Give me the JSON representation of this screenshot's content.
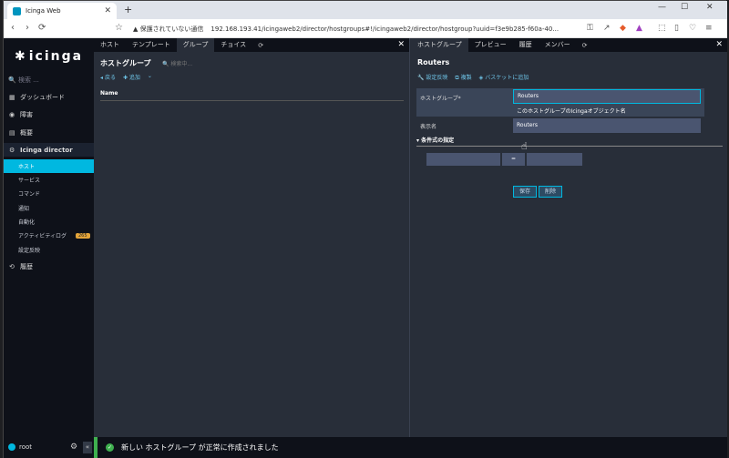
{
  "browser": {
    "tab_title": "Icinga Web",
    "new_tab": "+",
    "security_warning": "▲ 保護されていない通信",
    "url": "192.168.193.41/icingaweb2/director/hostgroups#!/icingaweb2/director/hostgroup?uuid=f3e9b285-f60a-40..."
  },
  "sidebar": {
    "logo": "icinga",
    "search": "検索 ...",
    "items": [
      {
        "label": "ダッシュボード",
        "icon": "dashboard-icon"
      },
      {
        "label": "障害",
        "icon": "problems-icon"
      },
      {
        "label": "概要",
        "icon": "overview-icon"
      },
      {
        "label": "Icinga director",
        "icon": "director-icon"
      },
      {
        "label": "ホスト"
      },
      {
        "label": "サービス"
      },
      {
        "label": "コマンド"
      },
      {
        "label": "通知"
      },
      {
        "label": "自動化"
      },
      {
        "label": "アクティビティログ",
        "badge": "265"
      },
      {
        "label": "設定反映"
      },
      {
        "label": "履歴",
        "icon": "history-icon"
      }
    ],
    "user": "root"
  },
  "left_panel": {
    "tabs": [
      "ホスト",
      "テンプレート",
      "グループ",
      "チョイス"
    ],
    "active_tab": "グループ",
    "title": "ホストグループ",
    "search_placeholder": "検索中...",
    "back": "戻る",
    "add": "追加",
    "column_name": "Name"
  },
  "right_panel": {
    "tabs": [
      "ホストグループ",
      "プレビュー",
      "履歴",
      "メンバー"
    ],
    "title": "Routers",
    "actions": [
      "設定反映",
      "複製",
      "バスケットに追加"
    ],
    "label_hostgroup": "ホストグループ*",
    "value_hostgroup": "Routers",
    "hint_hostgroup": "このホストグループのIcingaオブジェクト名",
    "label_display": "表示名",
    "value_display": "Routers",
    "section_condition": "▾ 条件式の指定",
    "operator": "=",
    "save": "保存",
    "delete": "削除"
  },
  "status": {
    "message": "新しい ホストグループ が正常に作成されました"
  }
}
